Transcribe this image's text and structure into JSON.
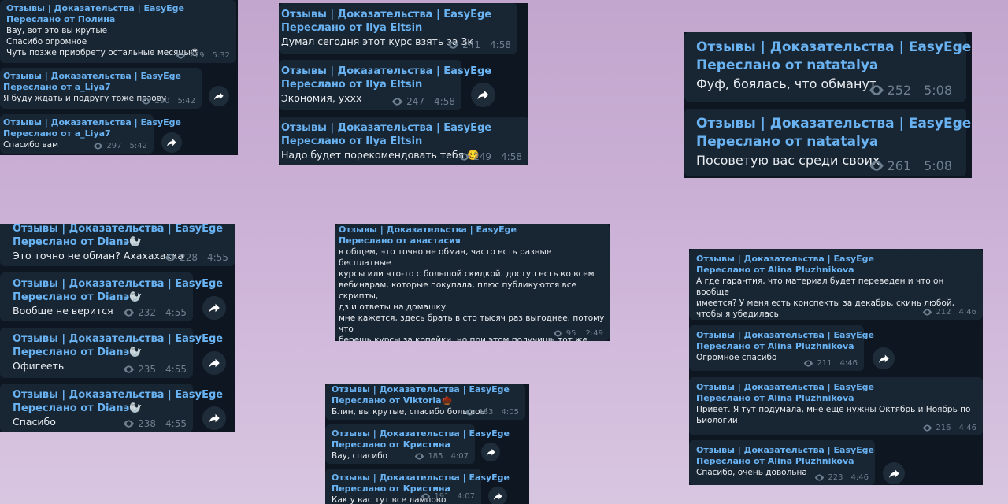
{
  "channel": "Отзывы | Доказательства | EasyEge",
  "fwd_prefix": "Переслано от",
  "s1": [
    {
      "from": "Переслано от Полина",
      "text": "Вау, вот это вы крутые\nСпасибо огромное\nЧуть позже приобрету остальные месяцы😍",
      "views": "279",
      "time": "5:32"
    },
    {
      "from": "Переслано от a_Liya7",
      "text": "Я буду ждать и подругу тоже позову",
      "views": "290",
      "time": "5:42"
    },
    {
      "from": "Переслано от a_Liya7",
      "text": "Спасибо вам",
      "views": "297",
      "time": "5:42"
    }
  ],
  "s2": [
    {
      "from": "Переслано от Ilya Eltsin",
      "text": "Думал сегодня этот курс взять за 3к",
      "views": "241",
      "time": "4:58"
    },
    {
      "from": "Переслано от Ilya Eltsin",
      "text": "Экономия, уххх",
      "views": "247",
      "time": "4:58"
    },
    {
      "from": "Переслано от Ilya Eltsin",
      "text": "Надо будет порекомендовать тебя 🥴",
      "views": "249",
      "time": "4:58"
    }
  ],
  "s3": [
    {
      "from": "Переслано от natatalya",
      "text": "Фуф, боялась, что обманут",
      "views": "252",
      "time": "5:08"
    },
    {
      "from": "Переслано от natatalya",
      "text": "Посоветую вас среди своих",
      "views": "261",
      "time": "5:08"
    }
  ],
  "s4": [
    {
      "from": "Переслано от Dianэ🦭",
      "text": "Это точно не обман? Ахахахахха",
      "views": "228",
      "time": "4:55"
    },
    {
      "from": "Переслано от Dianэ🦭",
      "text": "Вообще не верится",
      "views": "232",
      "time": "4:55"
    },
    {
      "from": "Переслано от Dianэ🦭",
      "text": "Офигееть",
      "views": "235",
      "time": "4:55"
    },
    {
      "from": "Переслано от Dianэ🦭",
      "text": "Спасибо",
      "views": "238",
      "time": "4:55"
    }
  ],
  "s5": [
    {
      "from": "Переслано от анастасия",
      "text": "в общем, это точно не обман, часто есть разные бесплатные\nкурсы или что-то с большой скидкой. доступ есть ко всем\nвебинарам, которые покупала, плюс публикуются все скрипты,\nдз и ответы на домашку\nмне кажется, здесь брать в сто тысяч раз выгоднее, потому что\nберешь курсы за копейки, но при этом получишь тот же объем\nинформации + можно взять много предметов, если пока не\nзнаешь какой выбрать",
      "views": "95",
      "time": "2:49"
    }
  ],
  "s6": [
    {
      "from": "Переслано от Viktoria🌰",
      "text": "Блин, вы крутые, спасибо большое!",
      "views": "183",
      "time": "4:05"
    },
    {
      "from": "Переслано от Кристина",
      "text": "Вау, спасибо",
      "views": "185",
      "time": "4:07"
    },
    {
      "from": "Переслано от Кристина",
      "text": "Как у вас тут все лампово",
      "views": "191",
      "time": "4:07"
    }
  ],
  "s7": [
    {
      "from": "Переслано от Alina Pluzhnikova",
      "text": "А где гарантия, что материал будет переведен и что он вообще\nимеется? У меня есть конспекты за декабрь, скинь любой,\nчтобы я убедилась",
      "views": "212",
      "time": "4:46"
    },
    {
      "from": "Переслано от Alina Pluzhnikova",
      "text": "Огромное спасибо",
      "views": "211",
      "time": "4:46"
    },
    {
      "from": "Переслано от Alina Pluzhnikova",
      "text": "Привет. Я тут подумала, мне ещё нужны Октябрь и Ноябрь по\nБиологии",
      "views": "216",
      "time": "4:46"
    },
    {
      "from": "Переслано от Alina Pluzhnikova",
      "text": "Спасибо, очень довольна",
      "views": "223",
      "time": "4:46"
    }
  ],
  "icons": {
    "views": "eye-icon",
    "forward": "forward-arrow-icon"
  },
  "colors": {
    "bg": "#0e1621",
    "bubble": "#182533",
    "accent": "#6ab3f3",
    "meta": "#6d7f8f",
    "text": "#e9edf1"
  }
}
